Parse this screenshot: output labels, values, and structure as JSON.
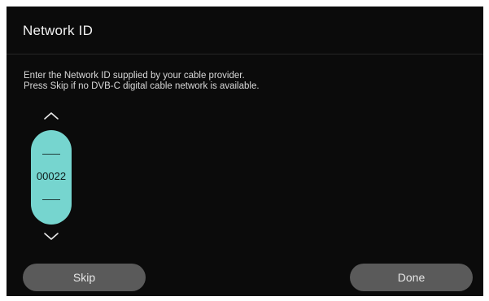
{
  "dialog": {
    "title": "Network ID",
    "instructions": [
      "Enter the Network ID supplied by your cable provider.",
      "Press Skip if no DVB-C digital cable network is available."
    ]
  },
  "picker": {
    "value": "00022",
    "up_icon": "chevron-up-icon",
    "down_icon": "chevron-down-icon"
  },
  "buttons": {
    "skip_label": "Skip",
    "done_label": "Done"
  },
  "colors": {
    "background": "#0b0b0b",
    "picker_accent": "#76d5cf",
    "button_bg": "#5a5a5a"
  }
}
